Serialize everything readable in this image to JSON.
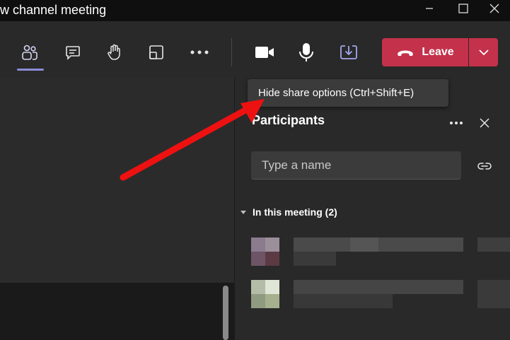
{
  "window": {
    "title": "w channel meeting"
  },
  "toolbar": {
    "leave_label": "Leave",
    "leave_color": "#c4314b",
    "accent_color": "#8b8cd8",
    "icons": [
      "people-icon",
      "chat-icon",
      "raise-hand-icon",
      "rooms-icon",
      "more-icon",
      "camera-icon",
      "mic-icon",
      "share-tray-icon",
      "phone-hangup-icon",
      "chevron-down-icon"
    ]
  },
  "tooltip": {
    "text": "Hide share options (Ctrl+Shift+E)"
  },
  "participants": {
    "title": "Participants",
    "search_placeholder": "Type a name",
    "section_label": "In this meeting (2)"
  }
}
